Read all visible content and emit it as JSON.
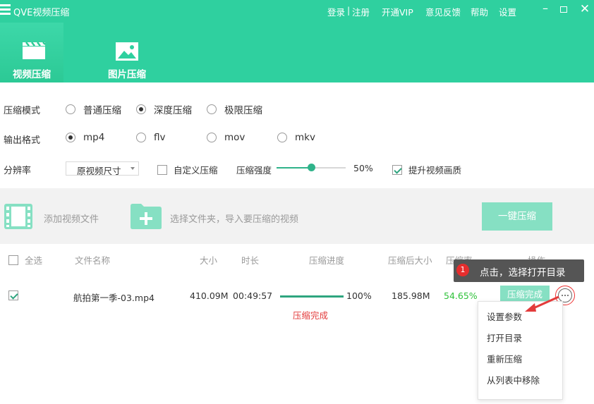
{
  "app": {
    "title": "QVE视频压缩"
  },
  "topmenu": {
    "login": "登录",
    "sep": "|",
    "register": "注册",
    "vip": "开通VIP",
    "feedback": "意见反馈",
    "help": "帮助",
    "settings": "设置"
  },
  "nav": {
    "video_tab": "视频压缩",
    "image_tab": "图片压缩"
  },
  "settings": {
    "mode_label": "压缩模式",
    "modes": [
      "普通压缩",
      "深度压缩",
      "极限压缩"
    ],
    "mode_selected": "深度压缩",
    "format_label": "输出格式",
    "formats": [
      "mp4",
      "flv",
      "mov",
      "mkv"
    ],
    "format_selected": "mp4",
    "resolution_label": "分辨率",
    "resolution_value": "原视频尺寸",
    "custom_label": "自定义压缩",
    "custom_checked": false,
    "strength_label": "压缩强度",
    "strength_value": "50%",
    "strength_fraction": 0.5,
    "enhance_label": "提升视频画质",
    "enhance_checked": true
  },
  "addbar": {
    "add_video": "添加视频文件",
    "choose_folder": "选择文件夹，导入要压缩的视频",
    "one_key": "一键压缩"
  },
  "table": {
    "headers": {
      "select_all": "全选",
      "name": "文件名称",
      "size": "大小",
      "duration": "时长",
      "progress": "压缩进度",
      "after_size": "压缩后大小",
      "ratio": "压缩率",
      "action": "操作"
    },
    "rows": [
      {
        "name": "航拍第一季-03.mp4",
        "size": "410.09M",
        "duration": "00:49:57",
        "progress": "100%",
        "progress_fraction": 1.0,
        "status": "压缩完成",
        "after_size": "185.98M",
        "ratio": "54.65%",
        "action_button": "压缩完成",
        "checked": true
      }
    ]
  },
  "tooltip": {
    "step": "1",
    "text": "点击，选择打开目录"
  },
  "context_menu": [
    "设置参数",
    "打开目录",
    "重新压缩",
    "从列表中移除"
  ],
  "colors": {
    "brand": "#2fd09f",
    "accent": "#2fa57f",
    "status_red": "#e33b3b",
    "ratio_green": "#2fc23a"
  }
}
